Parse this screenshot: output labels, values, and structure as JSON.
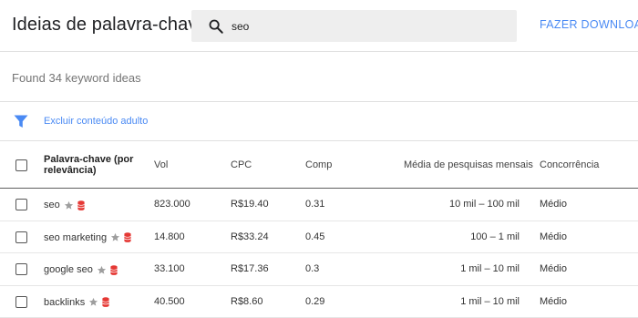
{
  "header": {
    "title": "Ideias de palavra-chave",
    "search_value": "seo",
    "download_label": "FAZER DOWNLOAD"
  },
  "summary": {
    "found_text": "Found 34 keyword ideas"
  },
  "filter": {
    "label": "Excluir conteúdo adulto"
  },
  "table": {
    "columns": {
      "keyword": "Palavra-chave (por relevância)",
      "vol": "Vol",
      "cpc": "CPC",
      "comp": "Comp",
      "media": "Média de pesquisas mensais",
      "concorrencia": "Concorrência"
    },
    "rows": [
      {
        "keyword": "seo",
        "vol": "823.000",
        "cpc": "R$19.40",
        "comp": "0.31",
        "media": "10 mil – 100 mil",
        "concorrencia": "Médio"
      },
      {
        "keyword": "seo marketing",
        "vol": "14.800",
        "cpc": "R$33.24",
        "comp": "0.45",
        "media": "100 – 1 mil",
        "concorrencia": "Médio"
      },
      {
        "keyword": "google seo",
        "vol": "33.100",
        "cpc": "R$17.36",
        "comp": "0.3",
        "media": "1 mil – 10 mil",
        "concorrencia": "Médio"
      },
      {
        "keyword": "backlinks",
        "vol": "40.500",
        "cpc": "R$8.60",
        "comp": "0.29",
        "media": "1 mil – 10 mil",
        "concorrencia": "Médio"
      }
    ]
  },
  "icons": {
    "search": "search-icon",
    "filter": "filter-icon",
    "star": "star-icon",
    "database": "database-icon"
  },
  "colors": {
    "accent": "#4a8af4",
    "star": "#9e9e9e",
    "database": "#e53935",
    "search_bg": "#eeeeee"
  }
}
